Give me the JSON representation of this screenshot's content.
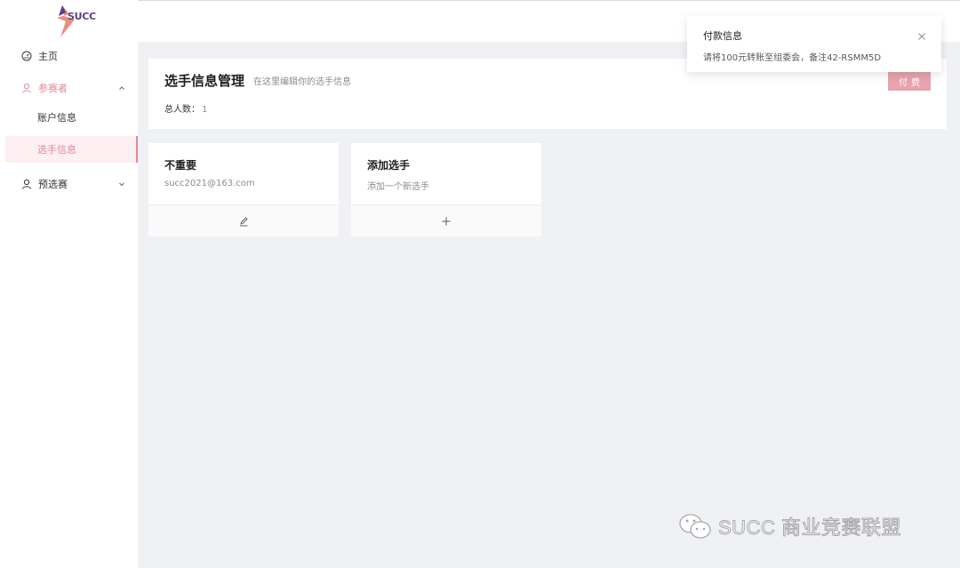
{
  "logo": {
    "text": "SUCC"
  },
  "sidebar": {
    "items": [
      {
        "label": "主页",
        "icon": "dashboard-icon"
      },
      {
        "label": "参赛者",
        "icon": "user-icon",
        "expanded": true,
        "children": [
          {
            "label": "账户信息"
          },
          {
            "label": "选手信息",
            "active": true
          }
        ]
      },
      {
        "label": "预选赛",
        "icon": "user-icon",
        "expanded": false
      }
    ]
  },
  "header": {
    "title": "选手信息管理",
    "subtitle": "在这里编辑你的选手信息",
    "total_label": "总人数：",
    "total_value": "1",
    "pay_button": "付费"
  },
  "cards": [
    {
      "title": "不重要",
      "desc": "succ2021@163.com",
      "action_icon": "edit-icon"
    },
    {
      "title": "添加选手",
      "desc": "添加一个新选手",
      "action_icon": "plus-icon"
    }
  ],
  "notification": {
    "title": "付款信息",
    "body": "请将100元转账至组委会，备注42-RSMM5D"
  },
  "watermark": {
    "text": "SUCC 商业竞赛联盟"
  },
  "colors": {
    "accent": "#e08a98",
    "button": "#e8a4ae",
    "background": "#f0f1f4"
  }
}
